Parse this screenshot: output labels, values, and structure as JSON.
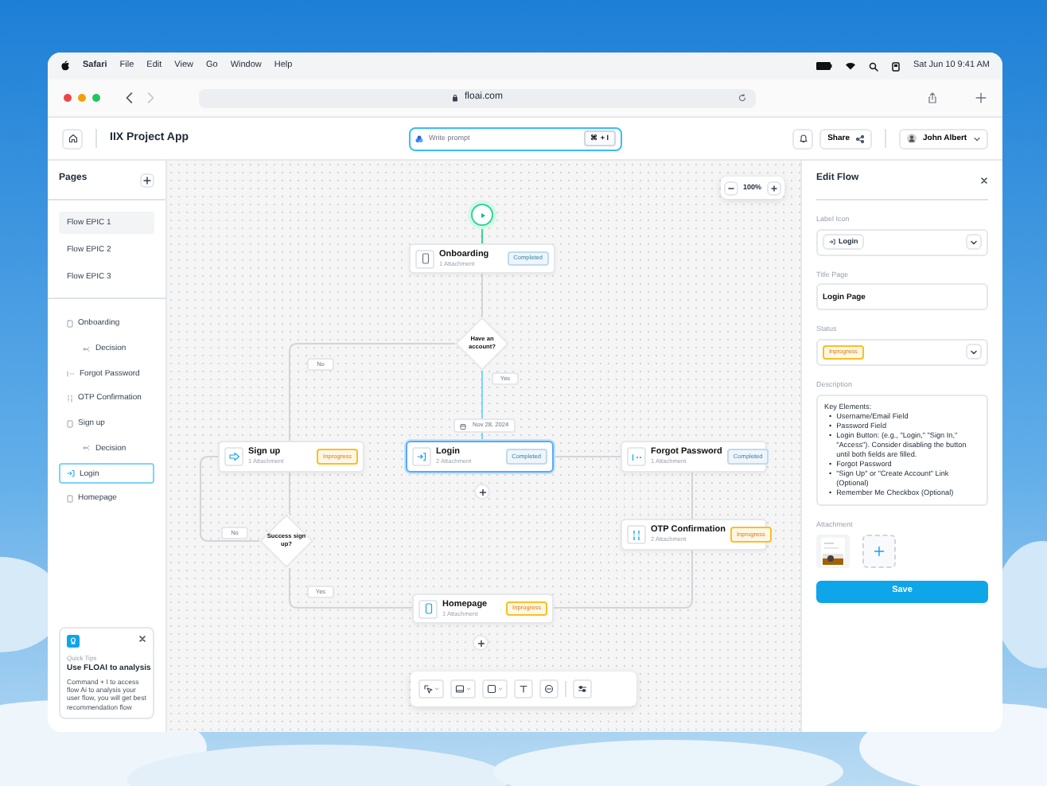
{
  "menu_bar": {
    "app": "Safari",
    "items": [
      "File",
      "Edit",
      "View",
      "Go",
      "Window",
      "Help"
    ],
    "clock": "Sat Jun 10  9:41 AM"
  },
  "browser": {
    "url": "floai.com"
  },
  "header": {
    "title": "IIX Project App",
    "prompt": {
      "placeholder": "Write prompt",
      "shortcut": "⌘ + I"
    },
    "share": "Share",
    "user": "John Albert"
  },
  "sidebar": {
    "title": "Pages",
    "pages": [
      {
        "label": "Flow EPIC 1",
        "selected": true
      },
      {
        "label": "Flow EPIC 2",
        "selected": false
      },
      {
        "label": "Flow EPIC 3",
        "selected": false
      }
    ],
    "tree": [
      {
        "label": "Onboarding",
        "selected": false,
        "children": [
          {
            "label": "Decision",
            "selected": false
          }
        ]
      },
      {
        "label": "Forgot Password",
        "selected": false
      },
      {
        "label": "OTP Confirmation",
        "selected": false
      },
      {
        "label": "Sign up",
        "selected": false,
        "children": [
          {
            "label": "Decision",
            "selected": false
          }
        ]
      },
      {
        "label": "Login",
        "selected": true
      },
      {
        "label": "Homepage",
        "selected": false
      }
    ],
    "tip": {
      "eyebrow": "Quick Tips",
      "title": "Use FLOAI to analysis",
      "text": "Command + I to access flow Ai to analysis your user flow, you will get best recommendation flow"
    }
  },
  "canvas": {
    "zoom": "100%",
    "nodes": [
      {
        "title": "Onboarding",
        "attachments": "1 Attachment",
        "badge": "Completed",
        "kind": "completed",
        "selected": false
      },
      {
        "title": "Sign up",
        "attachments": "1 Attachment",
        "badge": "Inprogress",
        "kind": "inprogress",
        "selected": false
      },
      {
        "title": "Login",
        "attachments": "2 Attachment",
        "badge": "Completed",
        "kind": "completed",
        "selected": true
      },
      {
        "title": "Forgot Password",
        "attachments": "1 Attachment",
        "badge": "Completed",
        "kind": "completed",
        "selected": false
      },
      {
        "title": "OTP Confirmation",
        "attachments": "2 Attachment",
        "badge": "Inprogress",
        "kind": "inprogress",
        "selected": false
      },
      {
        "title": "Homepage",
        "attachments": "1 Attachment",
        "badge": "Inprogress",
        "kind": "inprogress",
        "selected": false
      }
    ],
    "decisions": [
      "Have an account?",
      "Success sign up?"
    ],
    "branch_labels": [
      "No",
      "Yes",
      "No",
      "Yes"
    ],
    "date": "Nov 28, 2024"
  },
  "panel": {
    "title": "Edit Flow",
    "label_icon": {
      "label": "Label Icon",
      "value": "Login"
    },
    "title_page": {
      "label": "Title Page",
      "value": "Login Page"
    },
    "status": {
      "label": "Status",
      "value": "Inprogress",
      "kind": "inprogress"
    },
    "description": {
      "label": "Description",
      "heading": "Key Elements:",
      "marker": "•",
      "items": [
        "Username/Email Field",
        "Password Field",
        "Login Button: (e.g., \"Login,\" \"Sign In,\" \"Access\").  Consider disabling the button until both fields are filled.",
        "Forgot Password",
        "\"Sign Up\" or \"Create Account\" Link (Optional)",
        "Remember Me Checkbox (Optional)"
      ]
    },
    "attachment": {
      "label": "Attachment"
    },
    "save": "Save"
  }
}
